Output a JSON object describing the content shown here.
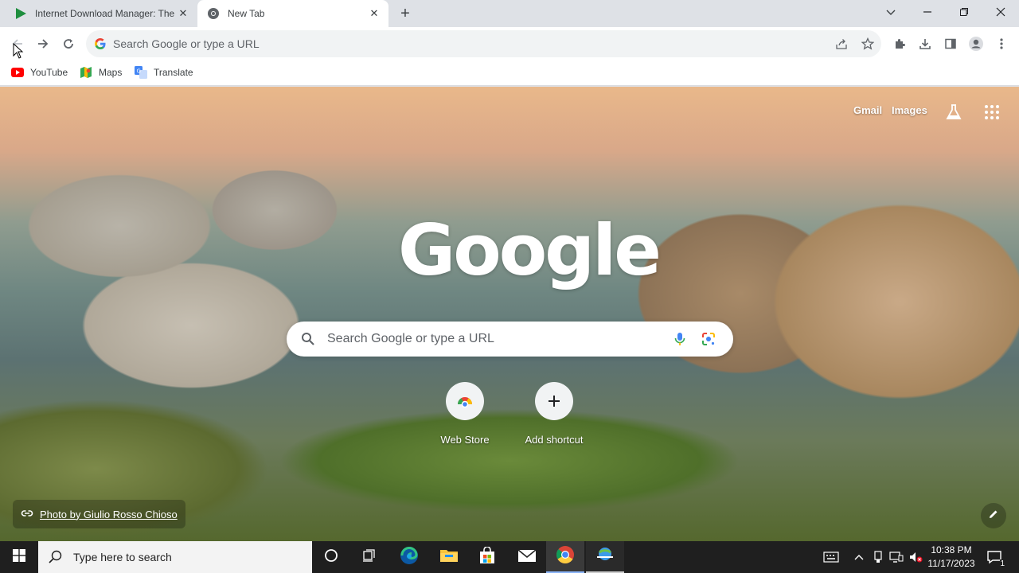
{
  "tabs": [
    {
      "title": "Internet Download Manager: The",
      "active": false,
      "favicon": "idm-play-icon"
    },
    {
      "title": "New Tab",
      "active": true,
      "favicon": "chrome-icon"
    }
  ],
  "omnibox": {
    "placeholder": "Search Google or type a URL"
  },
  "bookmarks": [
    {
      "label": "YouTube",
      "icon": "youtube-icon"
    },
    {
      "label": "Maps",
      "icon": "maps-icon"
    },
    {
      "label": "Translate",
      "icon": "translate-icon"
    }
  ],
  "ntp": {
    "gmail": "Gmail",
    "images": "Images",
    "logo": "Google",
    "search_placeholder": "Search Google or type a URL",
    "shortcuts": [
      {
        "label": "Web Store",
        "icon": "web-store-icon"
      },
      {
        "label": "Add shortcut",
        "icon": "plus-icon"
      }
    ],
    "attribution": "Photo by Giulio Rosso Chioso"
  },
  "taskbar": {
    "search_placeholder": "Type here to search",
    "time": "10:38 PM",
    "date": "11/17/2023",
    "notification_count": "1"
  },
  "colors": {
    "accent_blue": "#1a73e8",
    "tabstrip": "#dee1e6",
    "taskbar": "#1f1f1f"
  }
}
